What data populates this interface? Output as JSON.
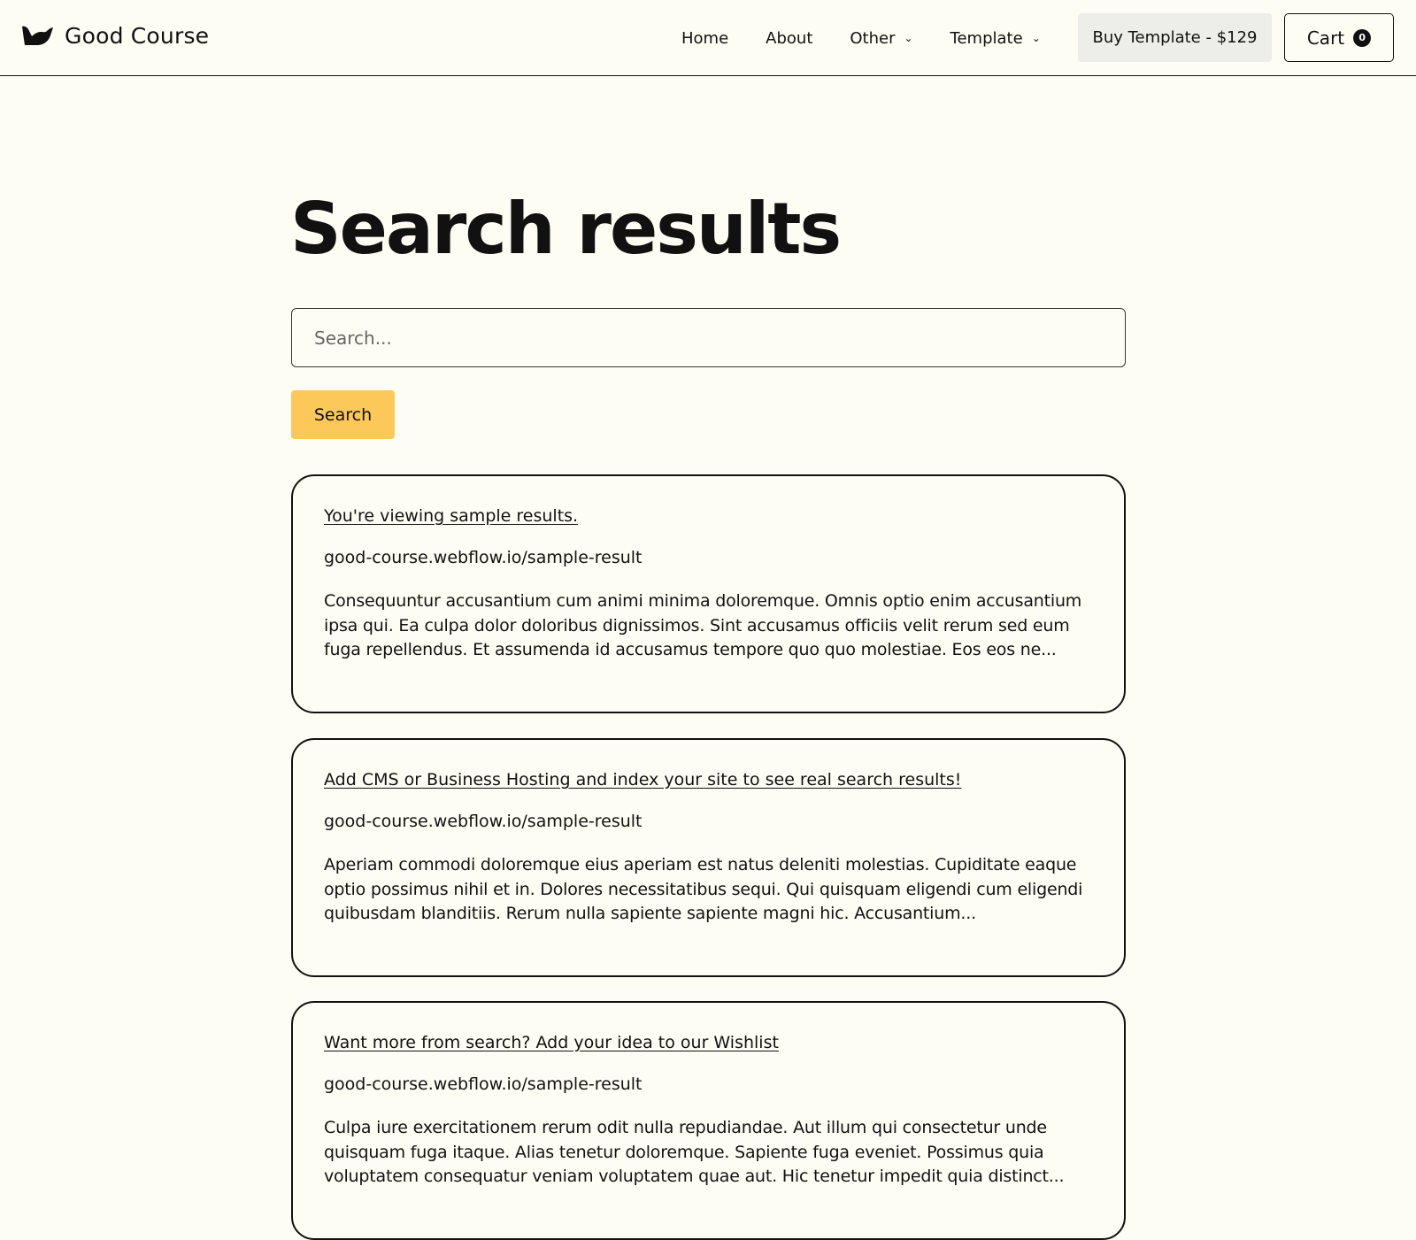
{
  "brand": {
    "name": "Good Course",
    "logo_icon": "bird-logo-icon"
  },
  "nav": {
    "links": [
      {
        "label": "Home"
      },
      {
        "label": "About"
      },
      {
        "label": "Other",
        "has_dropdown": true
      },
      {
        "label": "Template",
        "has_dropdown": true
      }
    ],
    "buy_label": "Buy Template - $129",
    "cart_label": "Cart",
    "cart_count": "0"
  },
  "page": {
    "title": "Search results"
  },
  "search": {
    "placeholder": "Search...",
    "value": "",
    "button_label": "Search"
  },
  "results": [
    {
      "title": "You're viewing sample results.",
      "url": "good-course.webflow.io/sample-result",
      "snippet": "Consequuntur accusantium cum animi minima doloremque. Omnis optio enim accusantium ipsa qui. Ea culpa dolor doloribus dignissimos. Sint accusamus officiis velit rerum sed eum fuga repellendus. Et assumenda id accusamus tempore quo quo molestiae. Eos eos ne..."
    },
    {
      "title": "Add CMS or Business Hosting and index your site to see real search results!",
      "url": "good-course.webflow.io/sample-result",
      "snippet": "Aperiam commodi doloremque eius aperiam est natus deleniti molestias. Cupiditate eaque optio possimus nihil et in. Dolores necessitatibus sequi. Qui quisquam eligendi cum eligendi quibusdam blanditiis. Rerum nulla sapiente sapiente magni hic. Accusantium..."
    },
    {
      "title": "Want more from search? Add your idea to our Wishlist",
      "url": "good-course.webflow.io/sample-result",
      "snippet": "Culpa iure exercitationem rerum odit nulla repudiandae. Aut illum qui consectetur unde quisquam fuga itaque. Alias tenetur doloremque. Sapiente fuga eveniet. Possimus quia voluptatem consequatur veniam voluptatem quae aut. Hic tenetur impedit quia distinct..."
    }
  ],
  "colors": {
    "background": "#fefdf4",
    "text": "#111111",
    "accent_button": "#fcc85a",
    "buy_button_bg": "#ededea"
  }
}
